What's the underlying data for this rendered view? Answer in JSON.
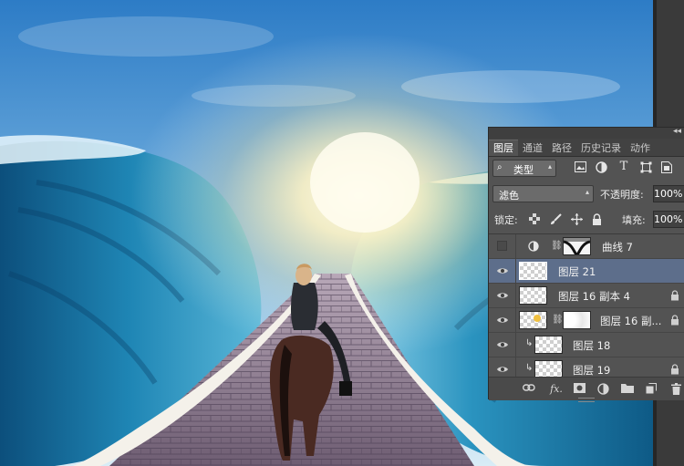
{
  "panel": {
    "tabs": [
      {
        "label": "图层",
        "active": true
      },
      {
        "label": "通道",
        "active": false
      },
      {
        "label": "路径",
        "active": false
      },
      {
        "label": "历史记录",
        "active": false
      },
      {
        "label": "动作",
        "active": false
      }
    ],
    "filter": {
      "value": "类型",
      "icon": "search-icon"
    },
    "filter_icons": [
      "image-filter-icon",
      "adjustment-filter-icon",
      "type-filter-icon",
      "shape-filter-icon",
      "smart-object-filter-icon"
    ],
    "blend_mode": "滤色",
    "opacity_label": "不透明度:",
    "opacity_value": "100%",
    "lock_label": "锁定:",
    "lock_icons": [
      "lock-transparent-icon",
      "lock-brush-icon",
      "lock-position-icon",
      "lock-all-icon"
    ],
    "fill_label": "填充:",
    "fill_value": "100%",
    "layers": [
      {
        "name": "曲线 7",
        "visible": false,
        "type": "adjustment",
        "selected": false,
        "locked": false
      },
      {
        "name": "图层 21",
        "visible": true,
        "type": "pixel",
        "selected": true,
        "locked": false
      },
      {
        "name": "图层 16 副本 4",
        "visible": true,
        "type": "pixel",
        "selected": false,
        "locked": true
      },
      {
        "name": "图层 16 副...",
        "visible": true,
        "type": "masked",
        "selected": false,
        "locked": true
      },
      {
        "name": "图层 18",
        "visible": true,
        "type": "clipped",
        "selected": false,
        "locked": false
      },
      {
        "name": "图层 19",
        "visible": true,
        "type": "clipped",
        "selected": false,
        "locked": true
      }
    ],
    "bottom_icons": [
      "link-layers-icon",
      "fx-icon",
      "add-mask-icon",
      "new-adjustment-icon",
      "new-group-icon",
      "new-layer-icon",
      "trash-icon"
    ],
    "fx_label": "fx."
  },
  "colors": {
    "panel_bg": "#535353",
    "selected_row": "#5d6e8b",
    "sky_top": "#2f7fc8",
    "wave": "#1d7aa6"
  }
}
